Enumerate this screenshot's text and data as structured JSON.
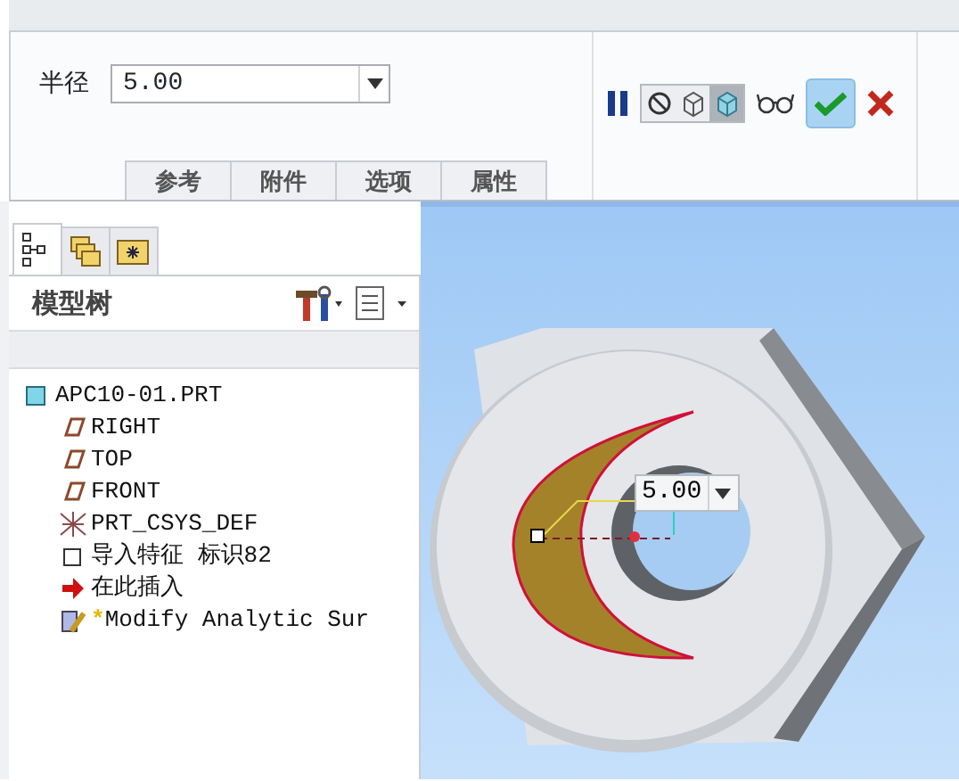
{
  "radius_field": {
    "label": "半径",
    "value": "5.00"
  },
  "preview_modes": [
    {
      "kind": "none",
      "selected": false
    },
    {
      "kind": "wire",
      "selected": false
    },
    {
      "kind": "shaded",
      "selected": true
    }
  ],
  "sub_tabs": [
    {
      "label": "参考"
    },
    {
      "label": "附件"
    },
    {
      "label": "选项"
    },
    {
      "label": "属性"
    }
  ],
  "nav_tabs": [
    {
      "kind": "tree",
      "selected": true
    },
    {
      "kind": "folders",
      "selected": false
    },
    {
      "kind": "favorites",
      "selected": false
    }
  ],
  "model_tree": {
    "title": "模型树",
    "items": [
      {
        "label": "APC10-01.PRT",
        "kind": "part",
        "children": [
          {
            "label": "RIGHT",
            "kind": "plane"
          },
          {
            "label": "TOP",
            "kind": "plane"
          },
          {
            "label": "FRONT",
            "kind": "plane"
          },
          {
            "label": "PRT_CSYS_DEF",
            "kind": "csys"
          },
          {
            "label": "导入特征 标识82",
            "kind": "import"
          },
          {
            "label": "在此插入",
            "kind": "insert"
          },
          {
            "label": "Modify Analytic Sur",
            "kind": "modify",
            "marker": "*"
          }
        ]
      }
    ]
  },
  "dimension": {
    "value": "5.00"
  }
}
